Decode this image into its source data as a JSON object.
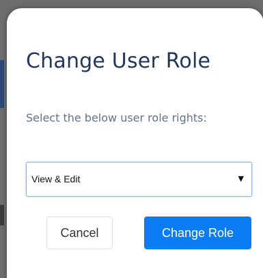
{
  "dialog": {
    "title": "Change User Role",
    "subtitle": "Select the below user role rights:",
    "role_select": {
      "selected": "View & Edit",
      "arrow": "▼"
    },
    "cancel_label": "Cancel",
    "confirm_label": "Change Role"
  },
  "colors": {
    "title": "#22375a",
    "subtitle": "#627388",
    "primary": "#0b7bf2",
    "backdrop": "#6d6d6d"
  },
  "icons": {
    "dropdown": "dropdown-arrow-icon"
  }
}
